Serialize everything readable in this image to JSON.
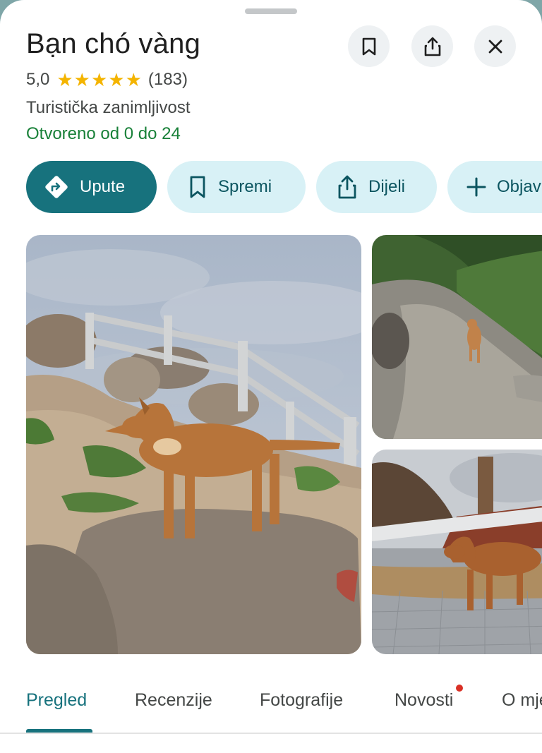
{
  "place": {
    "title": "Bạn chó vàng",
    "rating": "5,0",
    "stars": "★★★★★",
    "review_count": "(183)",
    "category": "Turistička zanimljivost",
    "hours": "Otvoreno od 0 do 24"
  },
  "header_icons": {
    "save": "bookmark-icon",
    "share": "share-icon",
    "close": "close-icon"
  },
  "actions": [
    {
      "label": "Upute",
      "icon": "directions-icon"
    },
    {
      "label": "Spremi",
      "icon": "bookmark-icon"
    },
    {
      "label": "Dijeli",
      "icon": "share-icon"
    },
    {
      "label": "Objavi",
      "icon": "plus-icon"
    }
  ],
  "tabs": [
    {
      "label": "Pregled",
      "active": true
    },
    {
      "label": "Recenzije",
      "active": false
    },
    {
      "label": "Fotografije",
      "active": false
    },
    {
      "label": "Novosti",
      "active": false,
      "notification": true
    },
    {
      "label": "O mjestu",
      "active": false
    }
  ],
  "colors": {
    "accent": "#17727d",
    "chip_bg": "#d8f1f6",
    "open_green": "#188038",
    "star": "#f4b400"
  }
}
